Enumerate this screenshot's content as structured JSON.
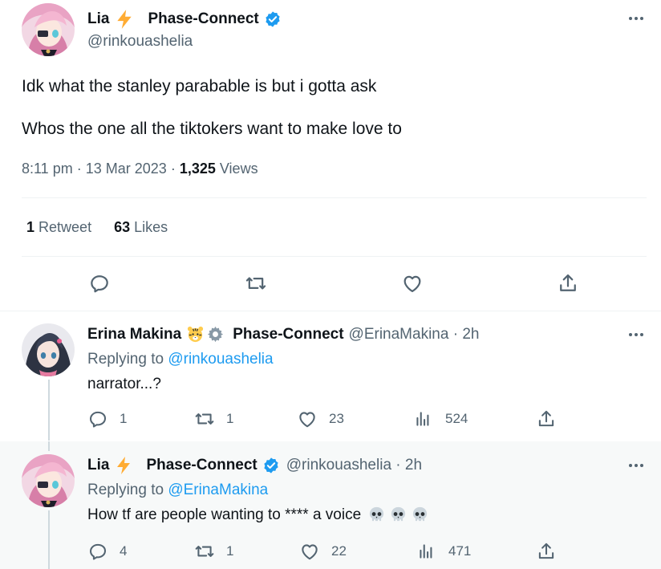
{
  "main_tweet": {
    "author_name": "Lia",
    "author_org": "Phase-Connect",
    "handle": "@rinkouashelia",
    "lines": [
      "Idk what the stanley parabable is but i gotta ask",
      "Whos the one all the tiktokers want to make love to"
    ],
    "time": "8:11 pm",
    "date": "13 Mar 2023",
    "views_count": "1,325",
    "views_label": "Views",
    "retweets_count": "1",
    "retweets_label": "Retweet",
    "likes_count": "63",
    "likes_label": "Likes"
  },
  "replies": [
    {
      "author_name": "Erina Makina",
      "author_org": "Phase-Connect",
      "handle": "@ErinaMakina",
      "time": "2h",
      "replying_prefix": "Replying to",
      "replying_to": "@rinkouashelia",
      "text": "narrator...?",
      "replies": "1",
      "retweets": "1",
      "likes": "23",
      "views": "524"
    },
    {
      "author_name": "Lia",
      "author_org": "Phase-Connect",
      "handle": "@rinkouashelia",
      "time": "2h",
      "replying_prefix": "Replying to",
      "replying_to": "@ErinaMakina",
      "text": "How tf are people wanting to **** a voice",
      "replies": "4",
      "retweets": "1",
      "likes": "22",
      "views": "471"
    }
  ],
  "colors": {
    "accent": "#1d9bf0",
    "text": "#0f1419",
    "muted": "#536471",
    "divider": "#eff3f4",
    "verified": "#1d9bf0",
    "lightning": "#ffac33"
  },
  "icons": [
    "verified-badge-icon",
    "lightning-emoji-icon",
    "tiger-emoji-icon",
    "gear-emoji-icon",
    "skull-emoji-icon",
    "reply-icon",
    "retweet-icon",
    "like-icon",
    "share-icon",
    "views-icon",
    "more-icon"
  ]
}
